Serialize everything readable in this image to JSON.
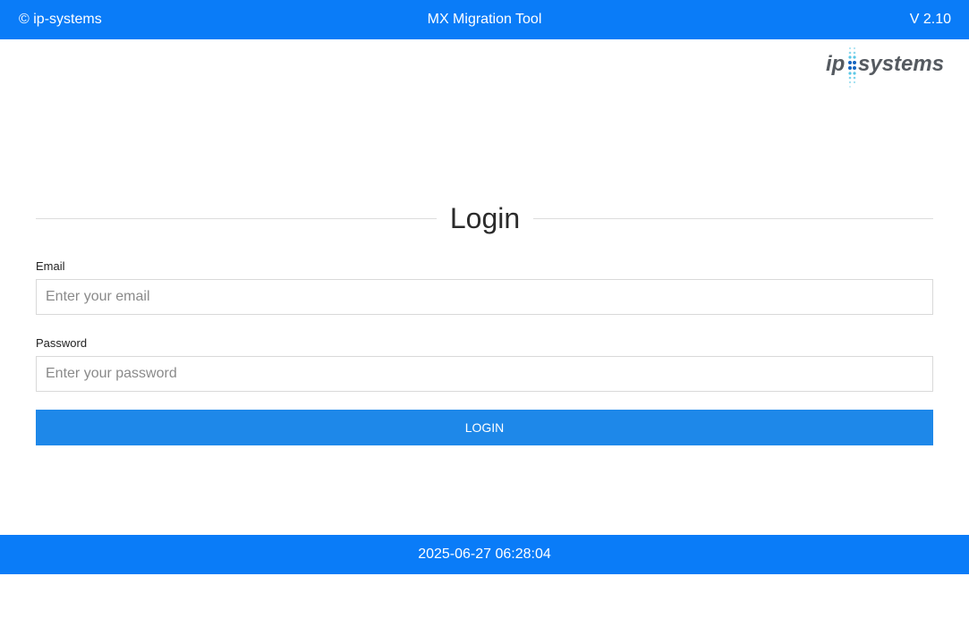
{
  "header": {
    "copyright": "© ip-systems",
    "app_title": "MX Migration Tool",
    "version": "V 2.10"
  },
  "logo": {
    "text_left": "ip",
    "text_right": "systems",
    "accent_color": "#5bc8e6"
  },
  "login": {
    "heading": "Login",
    "email_label": "Email",
    "email_placeholder": "Enter your email",
    "email_value": "",
    "password_label": "Password",
    "password_placeholder": "Enter your password",
    "password_value": "",
    "button_label": "LOGIN"
  },
  "footer": {
    "timestamp": "2025-06-27 06:28:04"
  },
  "colors": {
    "bar": "#0a7cf8",
    "button": "#1e88e9"
  }
}
